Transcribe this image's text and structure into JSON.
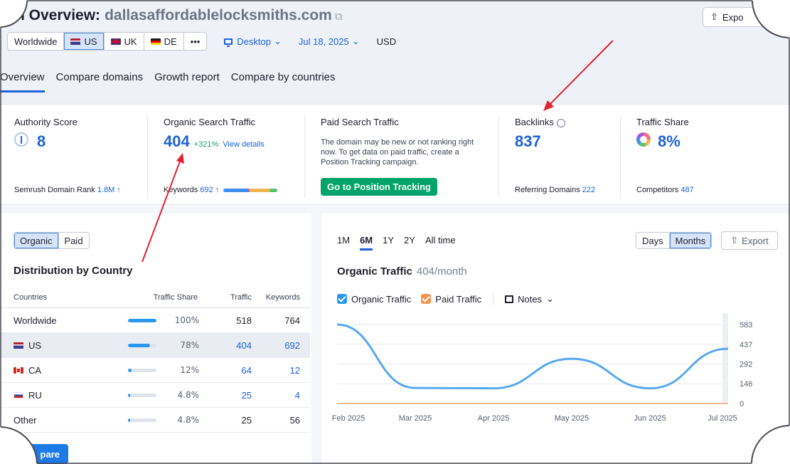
{
  "header": {
    "title_prefix": "h Overview:",
    "domain": "dallasaffordablelocksmiths.com",
    "export_label": "Expo",
    "locations": [
      "Worldwide",
      "US",
      "UK",
      "DE",
      "•••"
    ],
    "device": "Desktop",
    "date": "Jul 18, 2025",
    "currency": "USD",
    "tabs": [
      "Overview",
      "Compare domains",
      "Growth report",
      "Compare by countries"
    ]
  },
  "metrics": {
    "authority": {
      "label": "Authority Score",
      "value": "8",
      "foot_label": "Semrush Domain Rank",
      "foot_value": "1.8M ↑"
    },
    "organic": {
      "label": "Organic Search Traffic",
      "value": "404",
      "growth": "+321%",
      "details": "View details",
      "foot_label": "Keywords",
      "foot_value": "692 ↑"
    },
    "paid": {
      "label": "Paid Search Traffic",
      "text": "The domain may be new or not ranking right now. To get data on paid traffic, create a Position Tracking campaign.",
      "button": "Go to Position Tracking"
    },
    "backlinks": {
      "label": "Backlinks",
      "value": "837",
      "foot_label": "Referring Domains",
      "foot_value": "222"
    },
    "share": {
      "label": "Traffic Share",
      "value": "8%",
      "foot_label": "Competitors",
      "foot_value": "487"
    }
  },
  "left": {
    "toggle": [
      "Organic",
      "Paid"
    ],
    "title": "Distribution by Country",
    "columns": [
      "Countries",
      "Traffic Share",
      "Traffic",
      "Keywords"
    ],
    "rows": [
      {
        "name": "Worldwide",
        "share": "100%",
        "share_value": 100,
        "traffic": "518",
        "keywords": "764"
      },
      {
        "name": "US",
        "share": "78%",
        "share_value": 78,
        "traffic": "404",
        "keywords": "692"
      },
      {
        "name": "CA",
        "share": "12%",
        "share_value": 12,
        "traffic": "64",
        "keywords": "12"
      },
      {
        "name": "RU",
        "share": "4.8%",
        "share_value": 4.8,
        "traffic": "25",
        "keywords": "4"
      },
      {
        "name": "Other",
        "share": "4.8%",
        "share_value": 4.8,
        "traffic": "25",
        "keywords": "56"
      }
    ],
    "compare_button": "pare"
  },
  "right": {
    "ranges": [
      "1M",
      "6M",
      "1Y",
      "2Y",
      "All time"
    ],
    "active_range": "6M",
    "granularity": [
      "Days",
      "Months"
    ],
    "export_label": "Export",
    "title": "Organic Traffic",
    "subtitle": "404/month",
    "legend": {
      "organic": "Organic Traffic",
      "paid": "Paid Traffic",
      "notes": "Notes"
    }
  },
  "colors": {
    "accent": "#1e62d8",
    "organic_line": "#57a9ef",
    "paid_line": "#f5a26a",
    "green_button": "#00a46b",
    "organic_check": "#2b98f0",
    "paid_check": "#f5944e"
  },
  "chart_data": {
    "type": "line",
    "x": [
      "Feb 2025",
      "Mar 2025",
      "Apr 2025",
      "May 2025",
      "Jun 2025",
      "Jul 2025"
    ],
    "y_ticks": [
      0,
      146,
      292,
      437,
      583
    ],
    "ylim": [
      0,
      583
    ],
    "series": [
      {
        "name": "Organic Traffic",
        "points": [
          {
            "x": "Feb 2025",
            "y": 583
          },
          {
            "x": "Mar 2025",
            "y": 115
          },
          {
            "x": "Apr 2025",
            "y": 112
          },
          {
            "x": "May 2025",
            "y": 330
          },
          {
            "x": "Jun 2025",
            "y": 112
          },
          {
            "x": "Jul 2025",
            "y": 404
          }
        ]
      },
      {
        "name": "Paid Traffic",
        "points": [
          {
            "x": "Feb 2025",
            "y": 0
          },
          {
            "x": "Mar 2025",
            "y": 0
          },
          {
            "x": "Apr 2025",
            "y": 0
          },
          {
            "x": "May 2025",
            "y": 0
          },
          {
            "x": "Jun 2025",
            "y": 0
          },
          {
            "x": "Jul 2025",
            "y": 0
          }
        ]
      }
    ]
  }
}
